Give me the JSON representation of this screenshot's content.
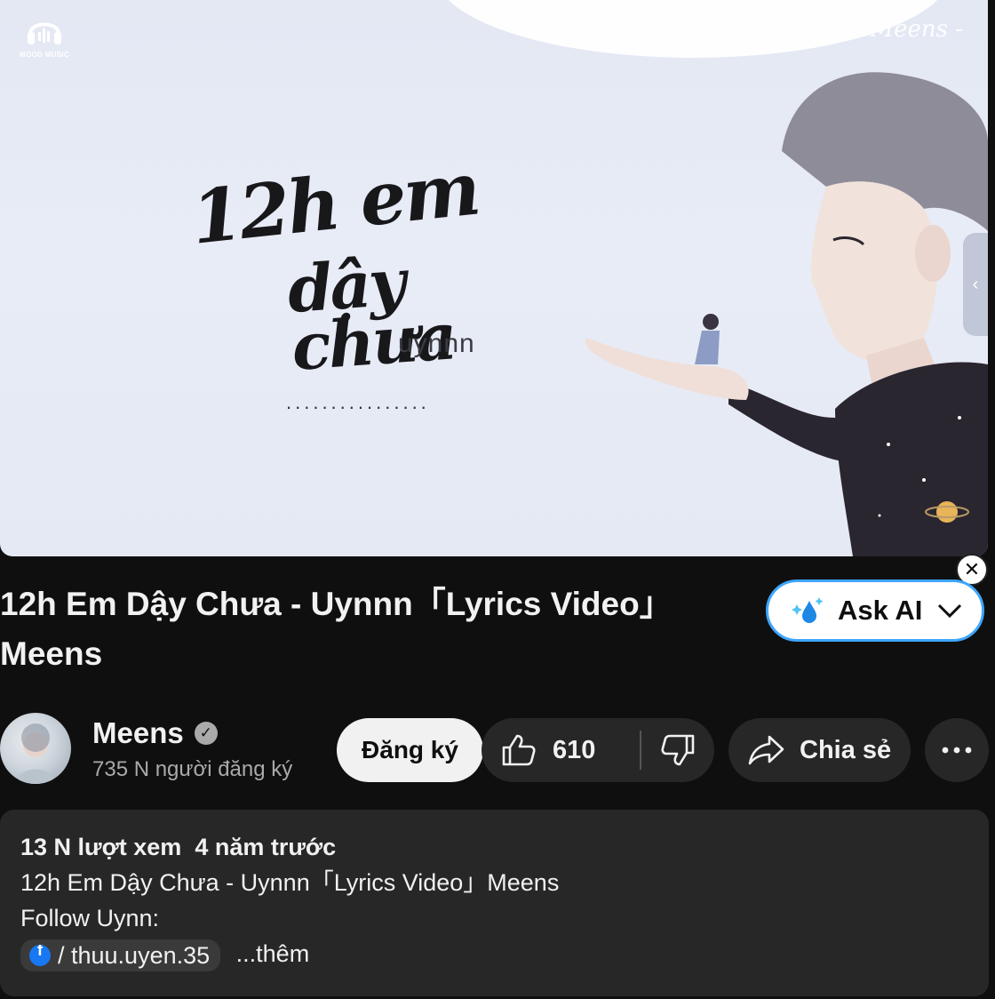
{
  "video": {
    "channel_logo_text": "MOOD MUSIC",
    "watermark": "- Meens -",
    "song_title_line1": "12h em",
    "song_title_line2": "dậy chưa",
    "artist": "uynnn",
    "dots": "................",
    "side_handle_icon": "chevron-left-icon"
  },
  "title": "12h Em Dậy Chưa - Uynnn「Lyrics Video」Meens",
  "ask_ai": {
    "label": "Ask AI",
    "icon": "sparkle-icon",
    "close_icon": "close-icon"
  },
  "channel": {
    "name": "Meens",
    "verified_icon": "verified-check-icon",
    "subscribers": "735 N người đăng ký",
    "subscribe_label": "Đăng ký"
  },
  "actions": {
    "like_count": "610",
    "share_label": "Chia sẻ",
    "more_icon": "more-horizontal-icon"
  },
  "description": {
    "meta": "13 N lượt xem  4 năm trước",
    "line1": "12h Em Dậy Chưa - Uynnn「Lyrics Video」Meens",
    "line2": "Follow Uynn:",
    "fb_handle": "/ thuu.uyen.35",
    "more_label": "...thêm"
  },
  "colors": {
    "background": "#0f0f0f",
    "surface": "#272727",
    "accent_blue": "#3ea6ff",
    "facebook": "#1877f2"
  }
}
